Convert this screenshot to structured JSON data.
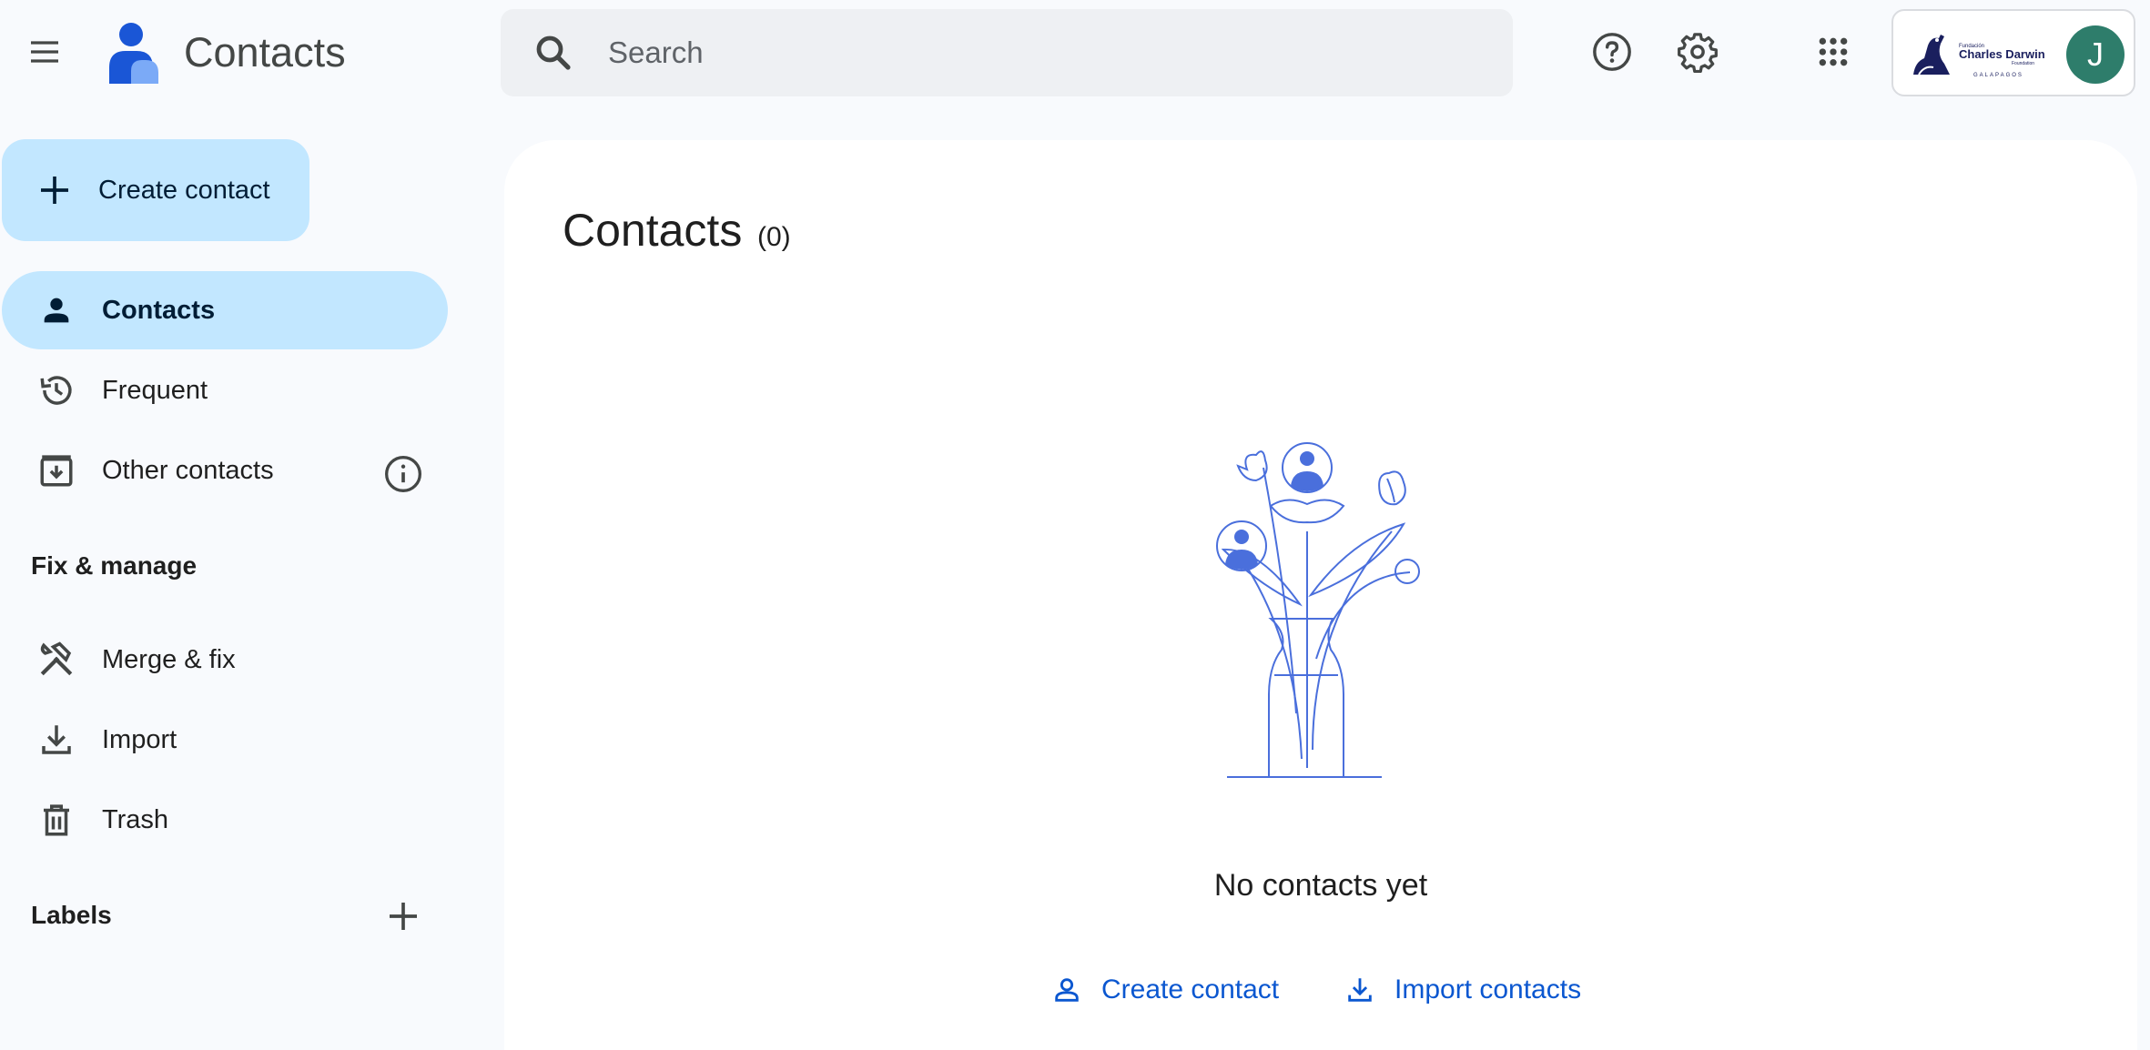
{
  "header": {
    "app_title": "Contacts",
    "search_placeholder": "Search",
    "icons": [
      "menu-icon",
      "contacts-logo-icon",
      "search-icon",
      "help-icon",
      "settings-icon",
      "apps-icon"
    ],
    "org_logo_text": [
      "Fundación",
      "Charles Darwin",
      "Foundation",
      "GALAPAGOS"
    ],
    "avatar_letter": "J",
    "avatar_color": "#2e7d6b"
  },
  "sidebar": {
    "create_label": "Create contact",
    "items": [
      {
        "label": "Contacts",
        "icon": "person-icon",
        "active": true
      },
      {
        "label": "Frequent",
        "icon": "history-icon"
      },
      {
        "label": "Other contacts",
        "icon": "archive-download-icon"
      }
    ],
    "fix_heading": "Fix & manage",
    "manage_items": [
      {
        "label": "Merge & fix",
        "icon": "merge-fix-icon"
      },
      {
        "label": "Import",
        "icon": "import-icon"
      },
      {
        "label": "Trash",
        "icon": "trash-icon"
      }
    ],
    "labels_heading": "Labels"
  },
  "main": {
    "title": "Contacts",
    "count": "(0)",
    "empty_text": "No contacts yet",
    "create_link": "Create contact",
    "import_link": "Import contacts"
  },
  "colors": {
    "accent": "#0b57d0",
    "active_bg": "#c2e7ff",
    "illustration": "#4a6fdc"
  }
}
